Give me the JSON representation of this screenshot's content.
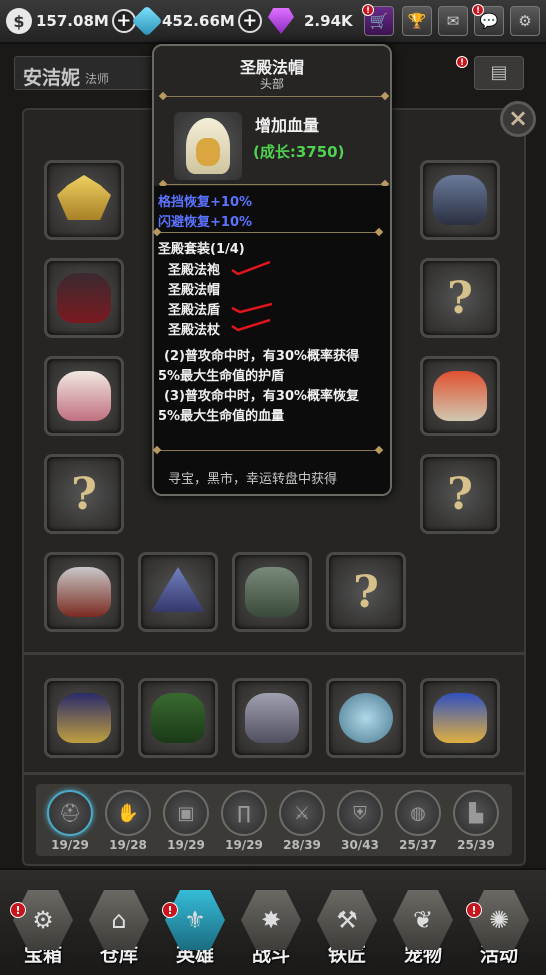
{
  "resources": {
    "gold": "157.08M",
    "crystal": "452.66M",
    "gem": "2.94K"
  },
  "hero": {
    "name": "安洁妮",
    "class": "法师"
  },
  "tooltip": {
    "item_name": "圣殿法帽",
    "slot": "头部",
    "attribute": "增加血量",
    "growth": "(成长:3750)",
    "bonuses": [
      "格挡恢复+10%",
      "闪避恢复+10%"
    ],
    "set_title": "圣殿套装(1/4)",
    "set_items": [
      "圣殿法袍",
      "圣殿法帽",
      "圣殿法盾",
      "圣殿法杖"
    ],
    "set_effects": [
      "(2)普攻命中时，有30%概率获得",
      "5%最大生命值的护盾",
      "(3)普攻命中时，有30%概率恢复",
      "5%最大生命值的血量"
    ],
    "source": "寻宝，黑市，幸运转盘中获得"
  },
  "progress": [
    {
      "icon": "helmet-icon",
      "count": "19/29"
    },
    {
      "icon": "gloves-icon",
      "count": "19/28"
    },
    {
      "icon": "armor-icon",
      "count": "19/29"
    },
    {
      "icon": "pants-icon",
      "count": "19/29"
    },
    {
      "icon": "sword-icon",
      "count": "28/39"
    },
    {
      "icon": "shield-icon",
      "count": "30/43"
    },
    {
      "icon": "amulet-icon",
      "count": "25/37"
    },
    {
      "icon": "boots-icon",
      "count": "25/39"
    }
  ],
  "nav": [
    {
      "label": "宝箱"
    },
    {
      "label": "仓库"
    },
    {
      "label": "英雄"
    },
    {
      "label": "战斗"
    },
    {
      "label": "铁匠"
    },
    {
      "label": "宠物"
    },
    {
      "label": "活动"
    }
  ],
  "colors": {
    "accent": "#36bcd8",
    "bonus_text": "#5b73ff",
    "growth_text": "#4fd24f",
    "alert": "#c8141c"
  }
}
